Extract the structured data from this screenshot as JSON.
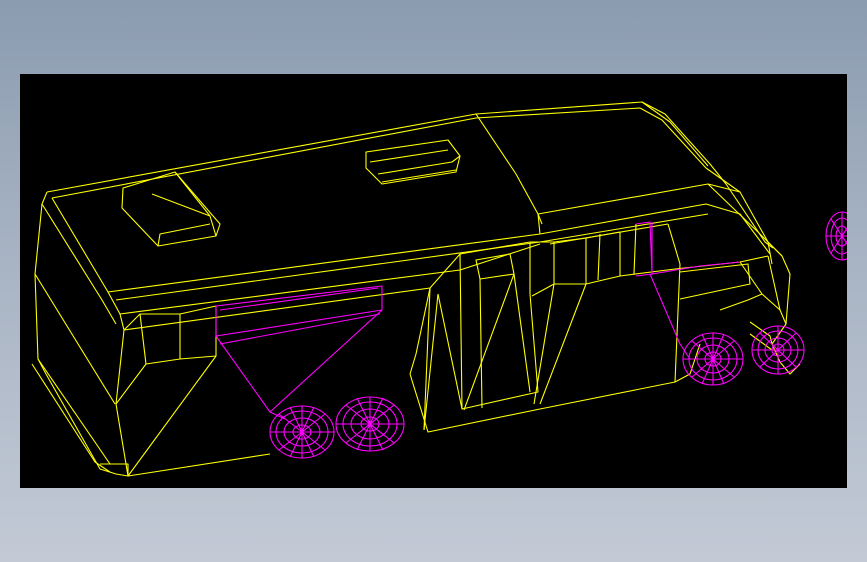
{
  "viewer": {
    "background_color": "#000000",
    "page_background": "#9aa8ba",
    "body_line_color": "#ffff00",
    "wheel_line_color": "#ff00ff"
  },
  "model": {
    "subject": "motorhome-wireframe",
    "wheel_count_visible": 4
  }
}
